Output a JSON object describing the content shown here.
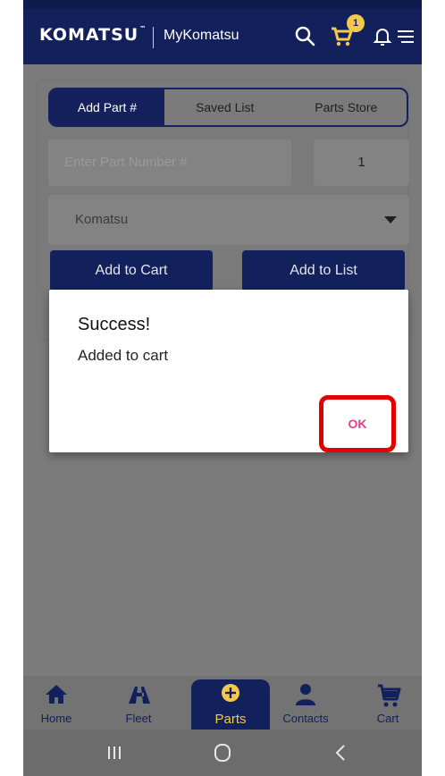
{
  "header": {
    "brand": "KOMATSU",
    "app_title": "MyKomatsu",
    "cart_badge": "1"
  },
  "tabs": [
    {
      "label": "Add Part #",
      "active": true
    },
    {
      "label": "Saved List",
      "active": false
    },
    {
      "label": "Parts Store",
      "active": false
    }
  ],
  "form": {
    "part_placeholder": "Enter Part Number #",
    "quantity": "1",
    "brand_selected": "Komatsu",
    "add_to_cart_label": "Add to Cart",
    "add_to_list_label": "Add to List"
  },
  "dialog": {
    "title": "Success!",
    "message": "Added to cart",
    "ok_label": "OK"
  },
  "bottom_nav": [
    {
      "label": "Home",
      "icon": "home-icon"
    },
    {
      "label": "Fleet",
      "icon": "fleet-icon"
    },
    {
      "label": "Parts",
      "icon": "plus-circle-icon",
      "active": true
    },
    {
      "label": "Contacts",
      "icon": "contacts-icon"
    },
    {
      "label": "Cart",
      "icon": "cart-icon"
    }
  ],
  "colors": {
    "navy": "#12205c",
    "accent_yellow": "#f2c94c",
    "ok_pink": "#e83e8c",
    "highlight_red": "#e30000"
  }
}
